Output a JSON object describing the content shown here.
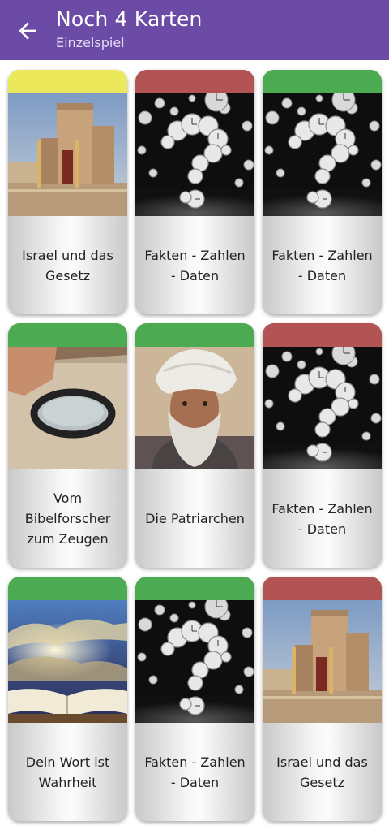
{
  "header": {
    "title": "Noch 4 Karten",
    "subtitle": "Einzelspiel",
    "back_icon": "arrow-back-icon",
    "background": "#6b4ba6"
  },
  "strip_colors": {
    "yellow": "#ebe85c",
    "red": "#b35454",
    "green": "#4caa52"
  },
  "cards": [
    {
      "label": "Israel und das Gesetz",
      "strip": "yellow",
      "image": "temple"
    },
    {
      "label": "Fakten - Zahlen - Daten",
      "strip": "red",
      "image": "clocks"
    },
    {
      "label": "Fakten - Zahlen - Daten",
      "strip": "green",
      "image": "clocks"
    },
    {
      "label": "Vom Bibelforscher zum Zeugen",
      "strip": "green",
      "image": "magnifier"
    },
    {
      "label": "Die Patriarchen",
      "strip": "green",
      "image": "patriarch"
    },
    {
      "label": "Fakten - Zahlen - Daten",
      "strip": "red",
      "image": "clocks"
    },
    {
      "label": "Dein Wort ist Wahrheit",
      "strip": "green",
      "image": "bible"
    },
    {
      "label": "Fakten - Zahlen - Daten",
      "strip": "green",
      "image": "clocks"
    },
    {
      "label": "Israel und das Gesetz",
      "strip": "red",
      "image": "temple"
    }
  ]
}
